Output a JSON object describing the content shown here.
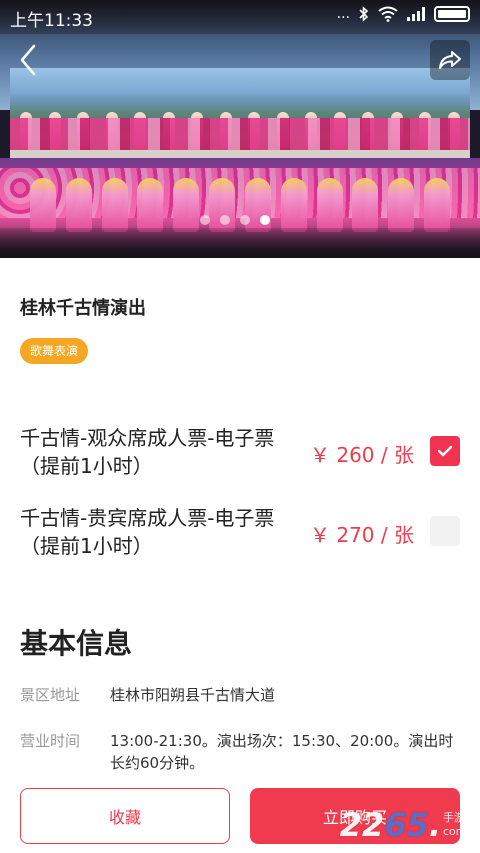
{
  "status_bar": {
    "time": "上午11:33",
    "dots": "..."
  },
  "hero": {
    "image": "stage-performance-photo",
    "carousel_total": 4,
    "carousel_active": 4
  },
  "product": {
    "title": "桂林千古情演出",
    "tag": "歌舞表演"
  },
  "tickets": [
    {
      "name": "千古情-观众席成人票-电子票（提前1小时）",
      "price": "￥ 260 / 张",
      "selected": true
    },
    {
      "name": "千古情-贵宾席成人票-电子票（提前1小时）",
      "price": "￥ 270 / 张",
      "selected": false
    }
  ],
  "basic_info": {
    "heading": "基本信息",
    "rows": [
      {
        "label": "景区地址",
        "value": "桂林市阳朔县千古情大道"
      },
      {
        "label": "营业时间",
        "value": "13:00-21:30。演出场次：15:30、20:00。演出时长约60分钟。"
      }
    ]
  },
  "actions": {
    "favorite": "收藏",
    "buy": "立即购买"
  },
  "watermark": {
    "number_a": "22",
    "number_b": "65",
    "dot": ".",
    "side_top": "手游网",
    "side_bottom": "com"
  },
  "colors": {
    "accent": "#f03a4e",
    "tag": "#f5a623",
    "price": "#ee3c4d"
  }
}
